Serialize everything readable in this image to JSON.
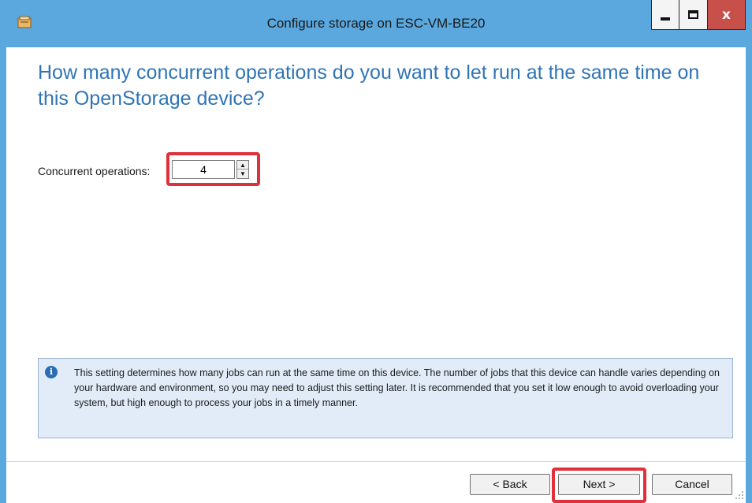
{
  "window": {
    "title": "Configure storage on ESC-VM-BE20",
    "controls": {
      "minimize": "minimize-icon",
      "maximize": "maximize-icon",
      "close": "x"
    }
  },
  "page": {
    "heading": "How many concurrent operations do you want to let run at the same time on this OpenStorage device?",
    "concurrent_label": "Concurrent operations:",
    "concurrent_value": "4",
    "info_text": "This setting determines how many jobs can run at the same time on this device. The number of jobs that this device can handle varies depending on your hardware and environment, so you may need to adjust this setting later. It is recommended that you set it low enough to avoid overloading your system, but high enough to process your jobs in a timely manner."
  },
  "buttons": {
    "back": "< Back",
    "next": "Next >",
    "cancel": "Cancel"
  },
  "colors": {
    "titlebar": "#5aa8de",
    "heading": "#2f75b5",
    "highlight": "#e0303a",
    "info_bg": "#e1ecf8",
    "close_button": "#c7504b"
  }
}
